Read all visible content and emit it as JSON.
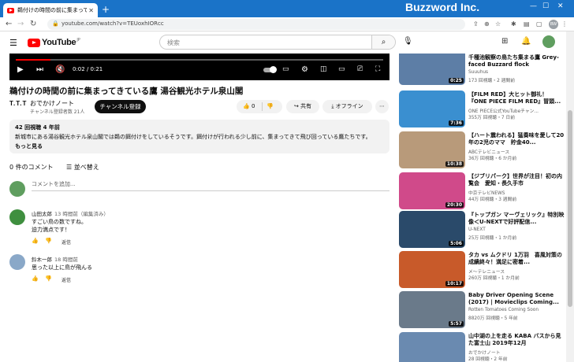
{
  "browser": {
    "tab_title": "鵜付けの時間の前に集まってきている",
    "new_tab": "+",
    "url": "youtube.com/watch?v=TEUoxhIORcc",
    "watermark": "Buzzword Inc.",
    "profile_initials": "BW"
  },
  "yt": {
    "logo_text": "YouTube",
    "logo_region": "JP",
    "search_placeholder": "検索"
  },
  "player": {
    "time": "0:02 / 0:21",
    "progress_fraction": 0.095
  },
  "video": {
    "title": "鵜付けの時間の前に集まってきている鷹 湯谷観光ホテル泉山閣",
    "channel_avatar": "T.T.T",
    "channel_name": "おでかけノート",
    "subscribers": "チャンネル登録者数 21人",
    "subscribe_label": "チャンネル登録",
    "like_count": "0",
    "share_label": "共有",
    "offline_label": "オフライン",
    "description_meta": "42 回視聴  4 年前",
    "description_text": "新城市にある湯谷観光ホテル泉山閣では鵜の餌付けをしているそうです。餌付けが行われる少し前に、集まってきて飛び回っている鷹たちです。",
    "description_more": "もっと見る"
  },
  "comments": {
    "count": "0 件のコメント",
    "sort_label": "並べ替え",
    "add_placeholder": "コメントを追加...",
    "items": [
      {
        "author": "山田太郎",
        "time": "13 時間前（編集済み）",
        "lines": [
          "すごい鳥の数ですね。",
          "迫力満点です！"
        ],
        "reply": "返信"
      },
      {
        "author": "鈴木一郎",
        "time": "18 時間前",
        "lines": [
          "思った以上に鳥が飛んる"
        ],
        "reply": "返信"
      }
    ]
  },
  "recommendations": [
    {
      "title": "千種池観察の鳥たち集まる鷹 Grey-faced Buzzard flock",
      "channel": "Suuuhus",
      "meta": "173 回視聴・2 週間前",
      "duration": "0:25",
      "thumb_color": "#5d7ea6"
    },
    {
      "title": "【FILM RED】大ヒット御礼！『ONE PIECE FILM RED』冒頭...",
      "channel": "ONE PIECE公式YouTubeチャン...",
      "meta": "355万 回視聴・7 日前",
      "duration": "7:36",
      "thumb_color": "#3a8fd0"
    },
    {
      "title": "【ハート震われる】猛奏味を愛して20年の2児のママ　貯金40...",
      "channel": "ABCテレビニュース",
      "meta": "36万 回視聴・6 か月前",
      "duration": "10:38",
      "thumb_color": "#b89a7a"
    },
    {
      "title": "【ジブリパーク】世界が注目！初の内覧会　愛知・長久手市",
      "channel": "中京テレビNEWS",
      "meta": "44万 回視聴・3 週間前",
      "duration": "20:30",
      "thumb_color": "#d04a8a"
    },
    {
      "title": "『トップガン マーヴェリック』特別映像＜U-NEXTで好評配信...",
      "channel": "U-NEXT",
      "meta": "25万 回視聴・1 か月前",
      "duration": "5:06",
      "thumb_color": "#2a4a6a"
    },
    {
      "title": "タカ vs ムクドリ 1万羽　喜風対策の成績終々！満足に密着...",
      "channel": "メ～テレニュース",
      "meta": "260万 回視聴・1 か月前",
      "duration": "10:17",
      "thumb_color": "#c85a2a"
    },
    {
      "title": "Baby Driver Opening Scene (2017) | Movieclips Coming...",
      "channel": "Rotten Tomatoes Coming Soon",
      "meta": "8820万 回視聴・5 年前",
      "duration": "5:57",
      "thumb_color": "#6a7a8a"
    },
    {
      "title": "山中湖の上を走る KABA バスから見た富士山 2019年12月",
      "channel": "おでかけノート",
      "meta": "28 回視聴・2 年前",
      "duration": "",
      "thumb_color": "#6a8ab0"
    }
  ]
}
